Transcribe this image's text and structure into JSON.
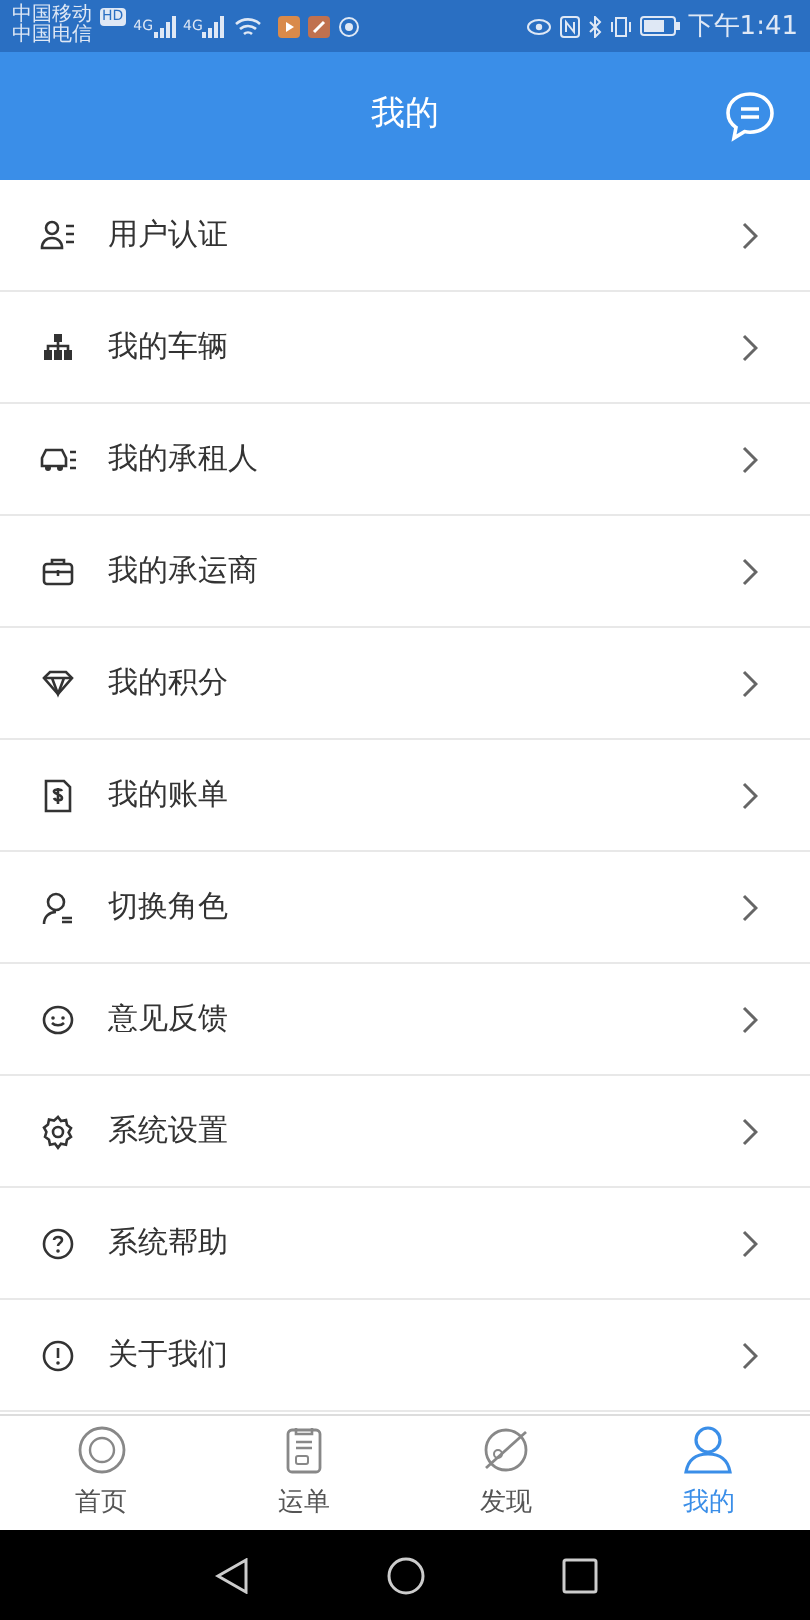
{
  "status_bar": {
    "carrier_1": "中国移动",
    "carrier_1_badge": "HD",
    "carrier_2": "中国电信",
    "network_1": "4G",
    "network_2": "4G",
    "time": "下午1:41"
  },
  "header": {
    "title": "我的"
  },
  "menu": [
    {
      "label": "用户认证"
    },
    {
      "label": "我的车辆"
    },
    {
      "label": "我的承租人"
    },
    {
      "label": "我的承运商"
    },
    {
      "label": "我的积分"
    },
    {
      "label": "我的账单"
    },
    {
      "label": "切换角色"
    },
    {
      "label": "意见反馈"
    },
    {
      "label": "系统设置"
    },
    {
      "label": "系统帮助"
    },
    {
      "label": "关于我们"
    }
  ],
  "tabs": [
    {
      "label": "首页",
      "selected": false
    },
    {
      "label": "运单",
      "selected": false
    },
    {
      "label": "发现",
      "selected": false
    },
    {
      "label": "我的",
      "selected": true
    }
  ]
}
